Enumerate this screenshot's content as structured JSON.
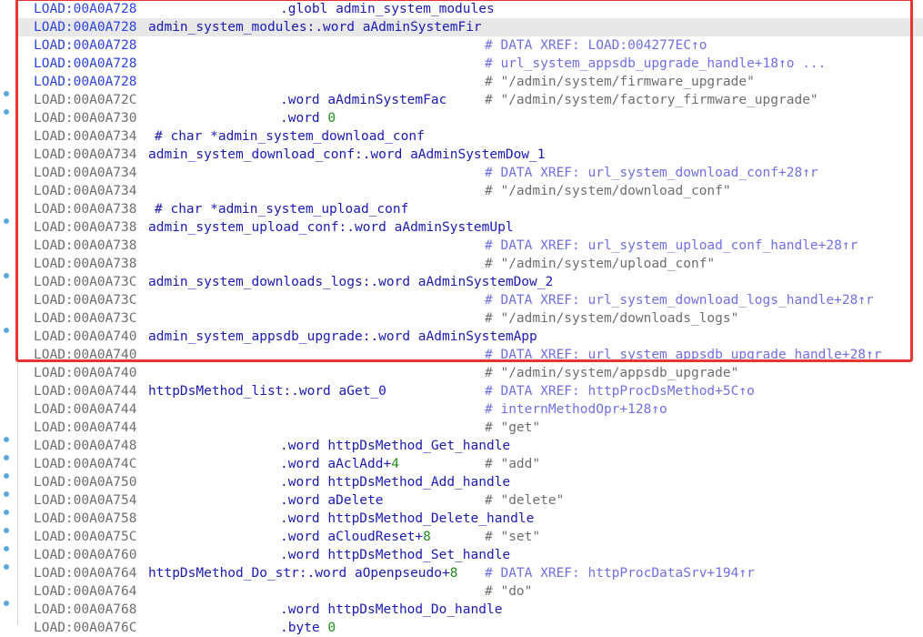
{
  "lines": [
    {
      "addr": "LOAD:00A0A728",
      "addr_color": "blue",
      "label": "",
      "mnemonic": ".globl admin_system_modules",
      "num": "",
      "comment": "",
      "comment_gray": false,
      "highlight": false,
      "func_comment": ""
    },
    {
      "addr": "LOAD:00A0A728",
      "addr_color": "blue",
      "label": "admin_system_modules:.word aAdminSystemFir",
      "mnemonic": "",
      "num": "",
      "comment": "",
      "comment_gray": false,
      "highlight": true,
      "func_comment": ""
    },
    {
      "addr": "LOAD:00A0A728",
      "addr_color": "blue",
      "label": "",
      "mnemonic": "",
      "num": "",
      "comment": "# DATA XREF: LOAD:004277EC↑o",
      "comment_gray": false,
      "highlight": false,
      "func_comment": ""
    },
    {
      "addr": "LOAD:00A0A728",
      "addr_color": "blue",
      "label": "",
      "mnemonic": "",
      "num": "",
      "comment": "# url_system_appsdb_upgrade_handle+18↑o ...",
      "comment_gray": false,
      "highlight": false,
      "func_comment": ""
    },
    {
      "addr": "LOAD:00A0A728",
      "addr_color": "blue",
      "label": "",
      "mnemonic": "",
      "num": "",
      "comment": "# \"/admin/system/firmware_upgrade\"",
      "comment_gray": true,
      "highlight": false,
      "func_comment": ""
    },
    {
      "addr": "LOAD:00A0A72C",
      "addr_color": "gray",
      "label": "",
      "mnemonic": ".word aAdminSystemFac",
      "num": "",
      "comment": "# \"/admin/system/factory_firmware_upgrade\"",
      "comment_gray": true,
      "highlight": false,
      "func_comment": ""
    },
    {
      "addr": "LOAD:00A0A730",
      "addr_color": "gray",
      "label": "",
      "mnemonic": ".word ",
      "num": "0",
      "comment": "",
      "comment_gray": false,
      "highlight": false,
      "func_comment": ""
    },
    {
      "addr": "LOAD:00A0A734",
      "addr_color": "gray",
      "label": "",
      "mnemonic": "",
      "num": "",
      "comment": "",
      "comment_gray": false,
      "highlight": false,
      "func_comment": "# char *admin_system_download_conf"
    },
    {
      "addr": "LOAD:00A0A734",
      "addr_color": "gray",
      "label": "admin_system_download_conf:.word aAdminSystemDow_1",
      "mnemonic": "",
      "num": "",
      "comment": "",
      "comment_gray": false,
      "highlight": false,
      "func_comment": ""
    },
    {
      "addr": "LOAD:00A0A734",
      "addr_color": "gray",
      "label": "",
      "mnemonic": "",
      "num": "",
      "comment": "# DATA XREF: url_system_download_conf+28↑r",
      "comment_gray": false,
      "highlight": false,
      "func_comment": ""
    },
    {
      "addr": "LOAD:00A0A734",
      "addr_color": "gray",
      "label": "",
      "mnemonic": "",
      "num": "",
      "comment": "# \"/admin/system/download_conf\"",
      "comment_gray": true,
      "highlight": false,
      "func_comment": ""
    },
    {
      "addr": "LOAD:00A0A738",
      "addr_color": "gray",
      "label": "",
      "mnemonic": "",
      "num": "",
      "comment": "",
      "comment_gray": false,
      "highlight": false,
      "func_comment": "# char *admin_system_upload_conf"
    },
    {
      "addr": "LOAD:00A0A738",
      "addr_color": "gray",
      "label": "admin_system_upload_conf:.word aAdminSystemUpl",
      "mnemonic": "",
      "num": "",
      "comment": "",
      "comment_gray": false,
      "highlight": false,
      "func_comment": ""
    },
    {
      "addr": "LOAD:00A0A738",
      "addr_color": "gray",
      "label": "",
      "mnemonic": "",
      "num": "",
      "comment": "# DATA XREF: url_system_upload_conf_handle+28↑r",
      "comment_gray": false,
      "highlight": false,
      "func_comment": ""
    },
    {
      "addr": "LOAD:00A0A738",
      "addr_color": "gray",
      "label": "",
      "mnemonic": "",
      "num": "",
      "comment": "# \"/admin/system/upload_conf\"",
      "comment_gray": true,
      "highlight": false,
      "func_comment": ""
    },
    {
      "addr": "LOAD:00A0A73C",
      "addr_color": "gray",
      "label": "admin_system_downloads_logs:.word aAdminSystemDow_2",
      "mnemonic": "",
      "num": "",
      "comment": "",
      "comment_gray": false,
      "highlight": false,
      "func_comment": ""
    },
    {
      "addr": "LOAD:00A0A73C",
      "addr_color": "gray",
      "label": "",
      "mnemonic": "",
      "num": "",
      "comment": "# DATA XREF: url_system_download_logs_handle+28↑r",
      "comment_gray": false,
      "highlight": false,
      "func_comment": ""
    },
    {
      "addr": "LOAD:00A0A73C",
      "addr_color": "gray",
      "label": "",
      "mnemonic": "",
      "num": "",
      "comment": "# \"/admin/system/downloads_logs\"",
      "comment_gray": true,
      "highlight": false,
      "func_comment": ""
    },
    {
      "addr": "LOAD:00A0A740",
      "addr_color": "gray",
      "label": "admin_system_appsdb_upgrade:.word aAdminSystemApp",
      "mnemonic": "",
      "num": "",
      "comment": "",
      "comment_gray": false,
      "highlight": false,
      "func_comment": ""
    },
    {
      "addr": "LOAD:00A0A740",
      "addr_color": "gray",
      "label": "",
      "mnemonic": "",
      "num": "",
      "comment": "# DATA XREF: url_system_appsdb_upgrade_handle+28↑r",
      "comment_gray": false,
      "highlight": false,
      "func_comment": ""
    },
    {
      "addr": "LOAD:00A0A740",
      "addr_color": "gray",
      "label": "",
      "mnemonic": "",
      "num": "",
      "comment": "# \"/admin/system/appsdb_upgrade\"",
      "comment_gray": true,
      "highlight": false,
      "func_comment": ""
    },
    {
      "addr": "LOAD:00A0A744",
      "addr_color": "gray",
      "label": "httpDsMethod_list:.word aGet_0",
      "mnemonic": "",
      "num": "",
      "comment": "# DATA XREF: httpProcDsMethod+5C↑o",
      "comment_gray": false,
      "highlight": false,
      "func_comment": ""
    },
    {
      "addr": "LOAD:00A0A744",
      "addr_color": "gray",
      "label": "",
      "mnemonic": "",
      "num": "",
      "comment": "# internMethodOpr+128↑o",
      "comment_gray": false,
      "highlight": false,
      "func_comment": ""
    },
    {
      "addr": "LOAD:00A0A744",
      "addr_color": "gray",
      "label": "",
      "mnemonic": "",
      "num": "",
      "comment": "# \"get\"",
      "comment_gray": true,
      "highlight": false,
      "func_comment": ""
    },
    {
      "addr": "LOAD:00A0A748",
      "addr_color": "gray",
      "label": "",
      "mnemonic": ".word httpDsMethod_Get_handle",
      "num": "",
      "comment": "",
      "comment_gray": false,
      "highlight": false,
      "func_comment": ""
    },
    {
      "addr": "LOAD:00A0A74C",
      "addr_color": "gray",
      "label": "",
      "mnemonic": ".word aAclAdd+",
      "num": "4",
      "comment": "# \"add\"",
      "comment_gray": true,
      "highlight": false,
      "func_comment": ""
    },
    {
      "addr": "LOAD:00A0A750",
      "addr_color": "gray",
      "label": "",
      "mnemonic": ".word httpDsMethod_Add_handle",
      "num": "",
      "comment": "",
      "comment_gray": false,
      "highlight": false,
      "func_comment": ""
    },
    {
      "addr": "LOAD:00A0A754",
      "addr_color": "gray",
      "label": "",
      "mnemonic": ".word aDelete",
      "num": "",
      "comment": "# \"delete\"",
      "comment_gray": true,
      "highlight": false,
      "func_comment": ""
    },
    {
      "addr": "LOAD:00A0A758",
      "addr_color": "gray",
      "label": "",
      "mnemonic": ".word httpDsMethod_Delete_handle",
      "num": "",
      "comment": "",
      "comment_gray": false,
      "highlight": false,
      "func_comment": ""
    },
    {
      "addr": "LOAD:00A0A75C",
      "addr_color": "gray",
      "label": "",
      "mnemonic": ".word aCloudReset+",
      "num": "8",
      "comment": "# \"set\"",
      "comment_gray": true,
      "highlight": false,
      "func_comment": ""
    },
    {
      "addr": "LOAD:00A0A760",
      "addr_color": "gray",
      "label": "",
      "mnemonic": ".word httpDsMethod_Set_handle",
      "num": "",
      "comment": "",
      "comment_gray": false,
      "highlight": false,
      "func_comment": ""
    },
    {
      "addr": "LOAD:00A0A764",
      "addr_color": "gray",
      "label": "httpDsMethod_Do_str:.word aOpenpseudo+",
      "mnemonic": "",
      "num": "8",
      "comment": "# DATA XREF: httpProcDataSrv+194↑r",
      "comment_gray": false,
      "highlight": false,
      "func_comment": ""
    },
    {
      "addr": "LOAD:00A0A764",
      "addr_color": "gray",
      "label": "",
      "mnemonic": "",
      "num": "",
      "comment": "# \"do\"",
      "comment_gray": true,
      "highlight": false,
      "func_comment": ""
    },
    {
      "addr": "LOAD:00A0A768",
      "addr_color": "gray",
      "label": "",
      "mnemonic": ".word httpDsMethod_Do_handle",
      "num": "",
      "comment": "",
      "comment_gray": false,
      "highlight": false,
      "func_comment": ""
    },
    {
      "addr": "LOAD:00A0A76C",
      "addr_color": "gray",
      "label": "",
      "mnemonic": ".byte ",
      "num": "0",
      "comment": "",
      "comment_gray": false,
      "highlight": false,
      "func_comment": ""
    }
  ],
  "gutter_dots": [
    5,
    6,
    12,
    15,
    18,
    24,
    25,
    26,
    27,
    28,
    29,
    30,
    31,
    33
  ]
}
